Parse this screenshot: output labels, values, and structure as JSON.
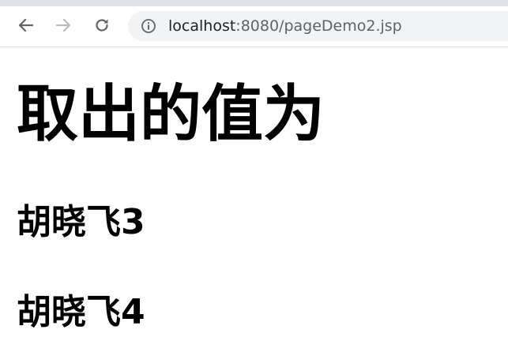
{
  "browser": {
    "url_host": "localhost",
    "url_rest": ":8080/pageDemo2.jsp",
    "icons": {
      "back": "arrow-left-icon",
      "forward": "arrow-right-icon",
      "reload": "reload-icon",
      "site_info": "info-icon"
    },
    "colors": {
      "tab_strip": "#dee1e6",
      "omnibox": "#f1f3f4",
      "icon": "#5f6368",
      "icon_disabled": "#b8bbbf"
    }
  },
  "page": {
    "title": "取出的值为",
    "values": [
      "胡晓飞3",
      "胡晓飞4"
    ]
  }
}
